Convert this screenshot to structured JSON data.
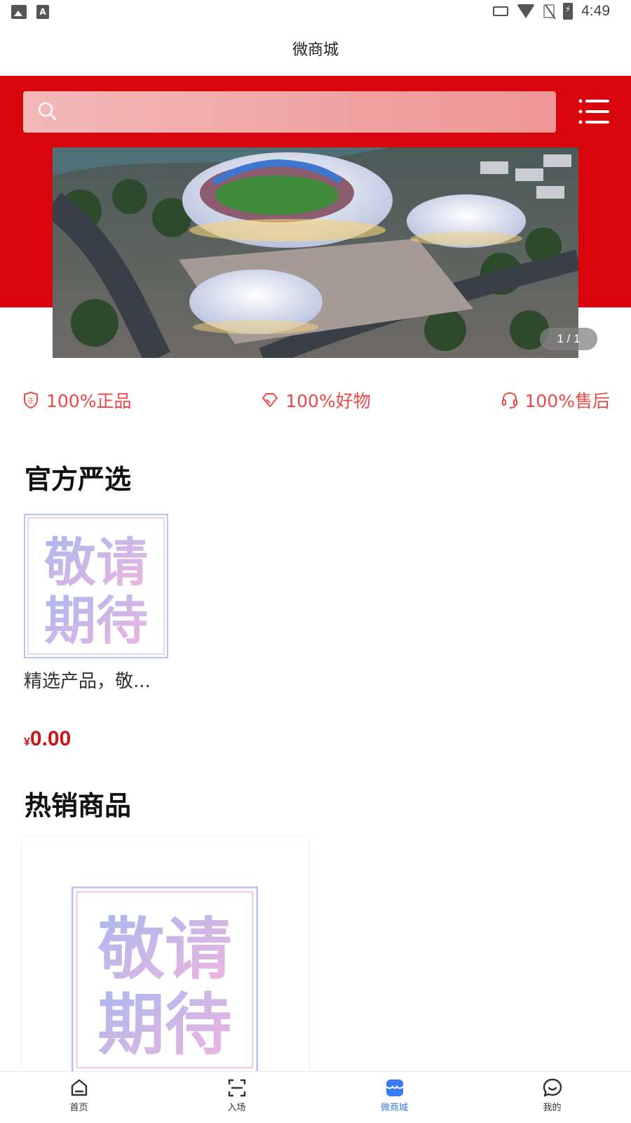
{
  "status_bar": {
    "time": "4:49"
  },
  "header": {
    "title": "微商城"
  },
  "search": {
    "placeholder": ""
  },
  "banner": {
    "pager": "1 / 1"
  },
  "guarantees": [
    {
      "icon": "shield-icon",
      "label": "100%正品"
    },
    {
      "icon": "diamond-icon",
      "label": "100%好物"
    },
    {
      "icon": "headset-icon",
      "label": "100%售后"
    }
  ],
  "placeholder_image_text": {
    "line1": "敬请",
    "line2": "期待"
  },
  "official_selection": {
    "title": "官方严选",
    "products": [
      {
        "name": "精选产品，敬...",
        "currency": "¥",
        "price": "0.00"
      }
    ]
  },
  "hot_products": {
    "title": "热销商品"
  },
  "tabbar": {
    "items": [
      {
        "label": "首页",
        "icon": "home-icon",
        "active": false
      },
      {
        "label": "入场",
        "icon": "scan-icon",
        "active": false
      },
      {
        "label": "微商城",
        "icon": "shop-icon",
        "active": true
      },
      {
        "label": "我的",
        "icon": "chat-icon",
        "active": false
      }
    ]
  },
  "colors": {
    "brand_red": "#d8060c",
    "price_red": "#c8161d",
    "guarantee_red": "#f04747",
    "tab_active": "#3a7bf5"
  }
}
